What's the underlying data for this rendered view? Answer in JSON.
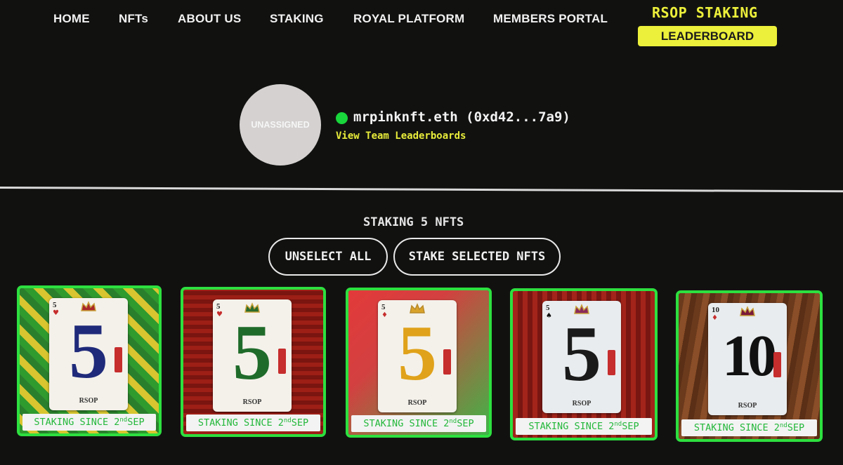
{
  "nav": {
    "items": [
      {
        "label": "HOME"
      },
      {
        "label": "NFTs"
      },
      {
        "label": "ABOUT US"
      },
      {
        "label": "STAKING"
      },
      {
        "label": "ROYAL PLATFORM"
      },
      {
        "label": "MEMBERS PORTAL"
      }
    ],
    "rsop_title": "RSOP STAKING",
    "leaderboard_label": "LEADERBOARD"
  },
  "profile": {
    "avatar_text": "UNASSIGNED",
    "wallet": "mrpinknft.eth (0xd42...7a9)",
    "team_link": "View Team Leaderboards",
    "status_color": "#18d63b"
  },
  "staking": {
    "count_text": "STAKING 5 NFTS",
    "unselect_label": "UNSELECT ALL",
    "stake_label": "STAKE SELECTED NFTS"
  },
  "nfts": [
    {
      "rank": "5",
      "suit": "♥",
      "brand": "RSOP",
      "caption_pre": "STAKING SINCE 2",
      "caption_sup": "nd",
      "caption_post": "SEP",
      "color": "#1f2a7a"
    },
    {
      "rank": "5",
      "suit": "♥",
      "brand": "RSOP",
      "caption_pre": "STAKING SINCE 2",
      "caption_sup": "nd",
      "caption_post": "SEP",
      "color": "#1f6b2a"
    },
    {
      "rank": "5",
      "suit": "♦",
      "brand": "RSOP",
      "caption_pre": "STAKING SINCE 2",
      "caption_sup": "nd",
      "caption_post": "SEP",
      "color": "#e0a21a"
    },
    {
      "rank": "5",
      "suit": "♠",
      "brand": "RSOP",
      "caption_pre": "STAKING SINCE 2",
      "caption_sup": "nd",
      "caption_post": "SEP",
      "color": "#1a1a1a"
    },
    {
      "rank": "10",
      "suit": "♦",
      "brand": "RSOP",
      "caption_pre": "STAKING SINCE 2",
      "caption_sup": "nd",
      "caption_post": "SEP",
      "color": "#111111"
    }
  ],
  "colors": {
    "accent_yellow": "#ecf03a",
    "selected_border": "#2de03f",
    "caption_text": "#24b83b"
  }
}
